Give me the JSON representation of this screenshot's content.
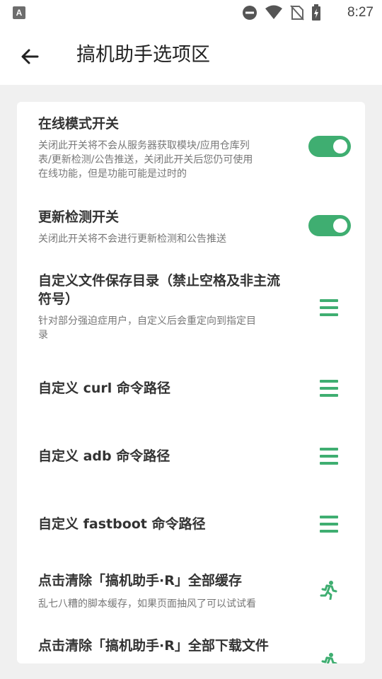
{
  "status_bar": {
    "time": "8:27",
    "left_icon_letter": "A",
    "icons": [
      "notification-a-icon",
      "dnd-icon",
      "wifi-icon",
      "no-sim-icon",
      "battery-charging-icon"
    ]
  },
  "header": {
    "title": "搞机助手选项区",
    "back_icon": "arrow-left-icon"
  },
  "settings": [
    {
      "title": "在线模式开关",
      "description": "关闭此开关将不会从服务器获取模块/应用仓库列表/更新检测/公告推送，关闭此开关后您仍可使用在线功能，但是功能可能是过时的",
      "description_lines": [
        "关闭此开关将不会从服务器获取模块/应用仓库列",
        "表/更新检测/公告推送，关闭此开关后您仍可使用",
        "在线功能，但是功能可能是过时的"
      ],
      "control": "toggle",
      "checked": true
    },
    {
      "title": "更新检测开关",
      "description_lines": [
        "关闭此开关将不会进行更新检测和公告推送"
      ],
      "control": "toggle",
      "checked": true
    },
    {
      "title_lines": [
        "自定义文件保存目录（禁止空格及非主流",
        "符号）"
      ],
      "description_lines": [
        "针对部分强迫症用户，自定义后会重定向到指定目",
        "录"
      ],
      "control": "menu-icon"
    },
    {
      "title": "自定义 curl 命令路径",
      "control": "menu-icon"
    },
    {
      "title": "自定义 adb 命令路径",
      "control": "menu-icon"
    },
    {
      "title": "自定义 fastboot 命令路径",
      "control": "menu-icon"
    },
    {
      "title": "点击清除「搞机助手·R」全部缓存",
      "description_lines": [
        "乱七八糟的脚本缓存，如果页面抽风了可以试试看"
      ],
      "control": "run-icon"
    },
    {
      "title": "点击清除「搞机助手·R」全部下载文件",
      "control": "run-icon"
    }
  ],
  "colors": {
    "accent": "#3fae71",
    "background": "#f0f0f0",
    "card": "#ffffff",
    "title_text": "#333333",
    "description_text": "#777777"
  }
}
